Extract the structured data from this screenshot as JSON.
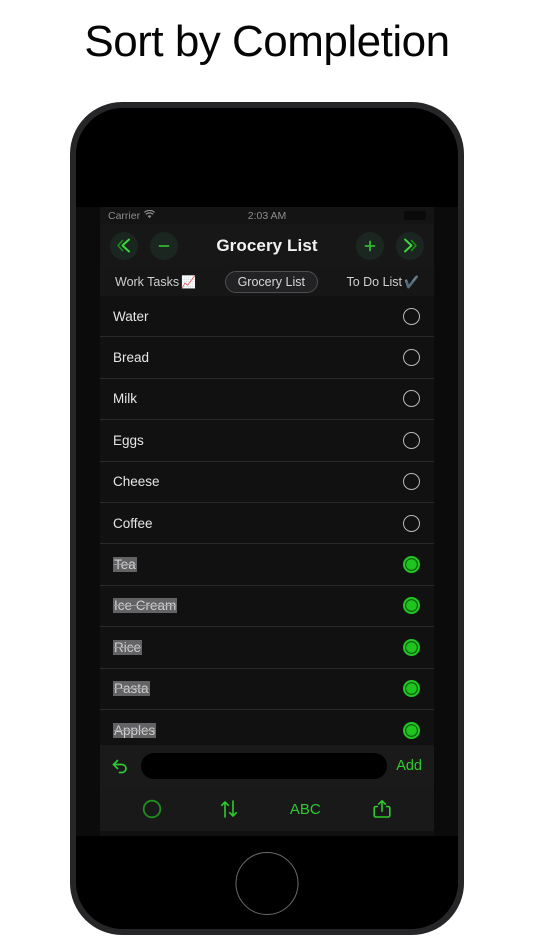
{
  "headline": "Sort by Completion",
  "colors": {
    "accent_green": "#2ecb2e",
    "checked_green": "#1fc41f",
    "screen_bg": "#111112",
    "nav_bg": "#171718",
    "text_primary": "#e7e7e7",
    "device_body": "#262628"
  },
  "status_bar": {
    "carrier": "Carrier",
    "wifi_icon": "wifi-icon",
    "time": "2:03 AM",
    "battery_icon": "battery-icon"
  },
  "nav_bar": {
    "title": "Grocery List",
    "prev_list_icon": "double-chevron-left-icon",
    "remove_icon": "minus-icon",
    "add_icon": "plus-icon",
    "next_list_icon": "double-chevron-right-icon"
  },
  "tabs": [
    {
      "label": "Work Tasks",
      "emoji": "📈",
      "emoji_name": "chart-increasing-icon",
      "selected": false
    },
    {
      "label": "Grocery List",
      "emoji": "",
      "emoji_name": "",
      "selected": true
    },
    {
      "label": "To Do List",
      "emoji": "✔️",
      "emoji_name": "check-mark-icon",
      "selected": false
    }
  ],
  "list": {
    "items": [
      {
        "label": "Water",
        "done": false
      },
      {
        "label": "Bread",
        "done": false
      },
      {
        "label": "Milk",
        "done": false
      },
      {
        "label": "Eggs",
        "done": false
      },
      {
        "label": "Cheese",
        "done": false
      },
      {
        "label": "Coffee",
        "done": false
      },
      {
        "label": "Tea",
        "done": true
      },
      {
        "label": "Ice Cream",
        "done": true
      },
      {
        "label": "Rice",
        "done": true
      },
      {
        "label": "Pasta",
        "done": true
      },
      {
        "label": "Apples",
        "done": true
      }
    ]
  },
  "input_bar": {
    "undo_icon": "undo-arrow-icon",
    "field_value": "",
    "field_placeholder": "",
    "add_label": "Add"
  },
  "toolbar": {
    "items": [
      {
        "name": "theme-contrast-icon",
        "label": ""
      },
      {
        "name": "sort-arrows-icon",
        "label": ""
      },
      {
        "name": "sort-alpha-button",
        "label": "ABC"
      },
      {
        "name": "share-icon",
        "label": ""
      }
    ]
  }
}
